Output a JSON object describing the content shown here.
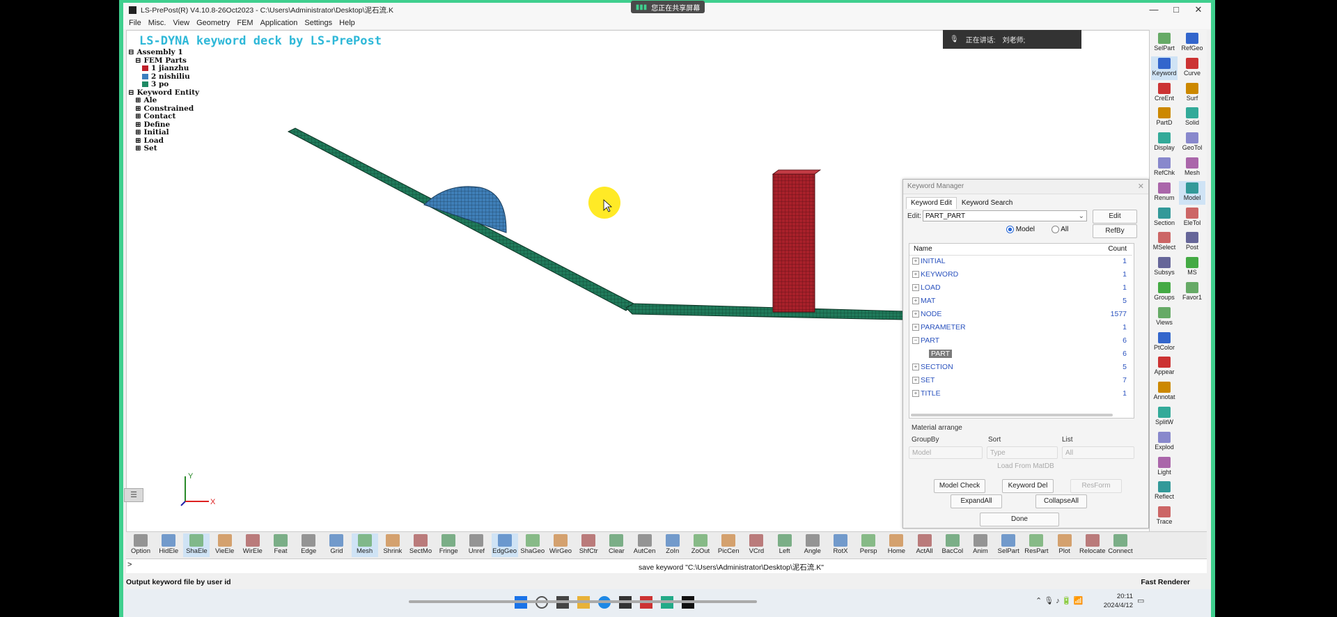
{
  "window": {
    "title": "LS-PrePost(R) V4.10.8-26Oct2023 - C:\\Users\\Administrator\\Desktop\\泥石流.K",
    "share_notice": "您正在共享屏幕",
    "controls": [
      "—",
      "□",
      "✕"
    ]
  },
  "menu": [
    "File",
    "Misc.",
    "View",
    "Geometry",
    "FEM",
    "Application",
    "Settings",
    "Help"
  ],
  "viewport": {
    "title": "LS-DYNA keyword deck by LS-PrePost",
    "axis_y": "Y",
    "axis_x": "X",
    "tree": {
      "assembly": "Assembly 1",
      "fem_parts": "FEM Parts",
      "parts": [
        {
          "label": "1 jianzhu",
          "color": "#c0202a"
        },
        {
          "label": "2 nishiliu",
          "color": "#3b7fbf"
        },
        {
          "label": "3 po",
          "color": "#1f8a64"
        }
      ],
      "keyword_entity": "Keyword Entity",
      "entities": [
        "Ale",
        "Constrained",
        "Contact",
        "Define",
        "Initial",
        "Load",
        "Set"
      ]
    }
  },
  "speaker": {
    "label": "正在讲话:",
    "name": "刘老师;"
  },
  "keyword_manager": {
    "title": "Keyword Manager",
    "tabs": [
      "Keyword Edit",
      "Keyword Search"
    ],
    "edit_label": "Edit:",
    "edit_value": "PART_PART",
    "edit_button": "Edit",
    "radio_model": "Model",
    "radio_all": "All",
    "refby_button": "RefBy",
    "col_name": "Name",
    "col_count": "Count",
    "rows": [
      {
        "name": "INITIAL",
        "count": "1",
        "exp": "+"
      },
      {
        "name": "KEYWORD",
        "count": "1",
        "exp": "+"
      },
      {
        "name": "LOAD",
        "count": "1",
        "exp": "+"
      },
      {
        "name": "MAT",
        "count": "5",
        "exp": "+"
      },
      {
        "name": "NODE",
        "count": "1577",
        "exp": "+"
      },
      {
        "name": "PARAMETER",
        "count": "1",
        "exp": "+"
      },
      {
        "name": "PART",
        "count": "6",
        "exp": "−"
      },
      {
        "name": "PART",
        "count": "6",
        "exp": ""
      },
      {
        "name": "SECTION",
        "count": "5",
        "exp": "+"
      },
      {
        "name": "SET",
        "count": "7",
        "exp": "+"
      },
      {
        "name": "TITLE",
        "count": "1",
        "exp": "+"
      }
    ],
    "material_arrange": "Material arrange",
    "groupby_label": "GroupBy",
    "sort_label": "Sort",
    "list_label": "List",
    "groupby_value": "Model",
    "sort_value": "Type",
    "list_value": "All",
    "load_from_matdb": "Load From MatDB",
    "model_check": "Model Check",
    "keyword_del": "Keyword Del",
    "resform": "ResForm",
    "expand_all": "ExpandAll",
    "collapse_all": "CollapseAll",
    "done": "Done"
  },
  "right_toolbar": [
    [
      "SelPart",
      "RefGeo"
    ],
    [
      "Keyword",
      "Curve"
    ],
    [
      "CreEnt",
      "Surf"
    ],
    [
      "PartD",
      "Solid"
    ],
    [
      "Display",
      "GeoTol"
    ],
    [
      "RefChk",
      "Mesh"
    ],
    [
      "Renum",
      "Model"
    ],
    [
      "Section",
      "EleTol"
    ],
    [
      "MSelect",
      "Post"
    ],
    [
      "Subsys",
      "MS"
    ],
    [
      "Groups",
      "Favor1"
    ],
    [
      "Views",
      ""
    ],
    [
      "PtColor",
      ""
    ],
    [
      "Appear",
      ""
    ],
    [
      "Annotat",
      ""
    ],
    [
      "SplitW",
      ""
    ],
    [
      "Explod",
      ""
    ],
    [
      "Light",
      ""
    ],
    [
      "Reflect",
      ""
    ],
    [
      "Trace",
      ""
    ]
  ],
  "bottom_toolbar": [
    "Option",
    "HidEle",
    "ShaEle",
    "VieEle",
    "WirEle",
    "Feat",
    "Edge",
    "Grid",
    "Mesh",
    "Shrink",
    "SectMo",
    "Fringe",
    "Unref",
    "EdgGeo",
    "ShaGeo",
    "WirGeo",
    "ShfCtr",
    "Clear",
    "AutCen",
    "ZoIn",
    "ZoOut",
    "PicCen",
    "VCrd",
    "Left",
    "Angle",
    "RotX",
    "Persp",
    "Home",
    "ActAll",
    "BacCol",
    "Anim",
    "SelPart",
    "ResPart",
    "Plot",
    "Relocate",
    "Connect"
  ],
  "command": {
    "prompt": ">",
    "history": "save keyword \"C:\\Users\\Administrator\\Desktop\\泥石流.K\""
  },
  "status": {
    "message": "Output keyword file by user id",
    "renderer": "Fast Renderer"
  },
  "taskbar": {
    "time": "20:11",
    "date": "2024/4/12"
  }
}
